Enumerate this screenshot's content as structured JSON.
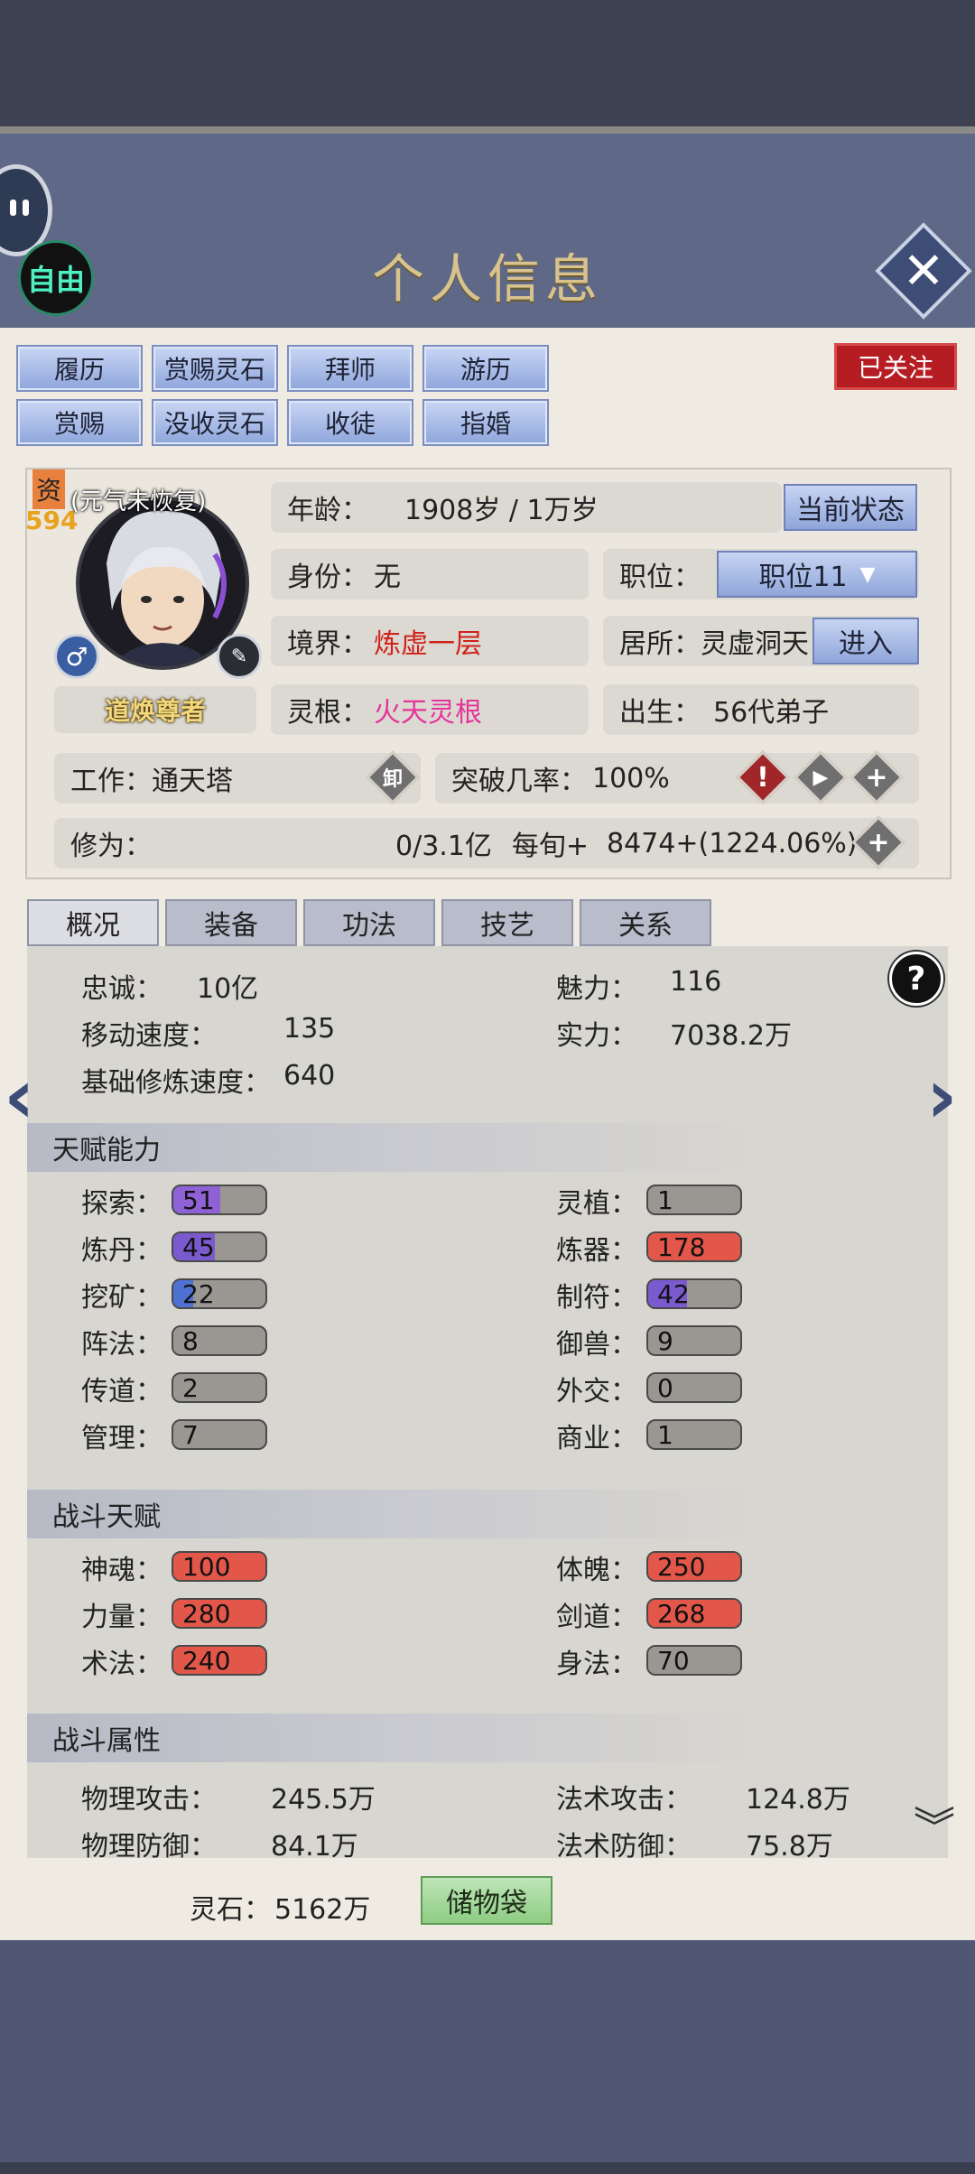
{
  "header": {
    "title": "个人信息",
    "free_label": "自由",
    "close_icon": "close-icon"
  },
  "top_buttons": [
    "履历",
    "赏赐灵石",
    "拜师",
    "游历",
    "赏赐",
    "没收灵石",
    "收徒",
    "指婚"
  ],
  "follow_label": "已关注",
  "character": {
    "zi_label": "资",
    "aptitude": "594",
    "status_note": "(元气未恢复)",
    "title_badge": "道焕尊者",
    "age_label": "年龄：",
    "age_value": "1908岁 / 1万岁",
    "current_status_label": "当前状态",
    "identity_label": "身份：",
    "identity_value": "无",
    "position_label": "职位：",
    "position_value": "职位11",
    "realm_label": "境界：",
    "realm_value": "炼虚一层",
    "residence_label": "居所：",
    "residence_value": "灵虚洞天",
    "enter_label": "进入",
    "root_label": "灵根：",
    "root_value": "火天灵根",
    "birth_label": "出生：",
    "birth_value": "56代弟子",
    "work_label": "工作：",
    "work_value": "通天塔",
    "unequip_label": "卸",
    "breakthrough_label": "突破几率：",
    "breakthrough_value": "100%",
    "cultivation_label": "修为：",
    "cultivation_value": "0/3.1亿",
    "per_turn_label": "每旬+",
    "per_turn_value": "8474+(1224.06%)"
  },
  "tabs": [
    "概况",
    "装备",
    "功法",
    "技艺",
    "关系"
  ],
  "overview": {
    "loyalty_label": "忠诚：",
    "loyalty_value": "10亿",
    "charm_label": "魅力：",
    "charm_value": "116",
    "speed_label": "移动速度：",
    "speed_value": "135",
    "power_label": "实力：",
    "power_value": "7038.2万",
    "base_speed_label": "基础修炼速度：",
    "base_speed_value": "640"
  },
  "talent_section": "天赋能力",
  "talents": [
    {
      "label": "探索：",
      "value": 51,
      "color": "#8f61d6"
    },
    {
      "label": "灵植：",
      "value": 1,
      "color": "#9a9793"
    },
    {
      "label": "炼丹：",
      "value": 45,
      "color": "#7b5ad0"
    },
    {
      "label": "炼器：",
      "value": 178,
      "color": "#e2574a"
    },
    {
      "label": "挖矿：",
      "value": 22,
      "color": "#4f72d2"
    },
    {
      "label": "制符：",
      "value": 42,
      "color": "#7b5ad0"
    },
    {
      "label": "阵法：",
      "value": 8,
      "color": "#9a9793"
    },
    {
      "label": "御兽：",
      "value": 9,
      "color": "#9a9793"
    },
    {
      "label": "传道：",
      "value": 2,
      "color": "#9a9793"
    },
    {
      "label": "外交：",
      "value": 0,
      "color": "#9a9793"
    },
    {
      "label": "管理：",
      "value": 7,
      "color": "#9a9793"
    },
    {
      "label": "商业：",
      "value": 1,
      "color": "#9a9793"
    }
  ],
  "combat_talent_section": "战斗天赋",
  "combat_talents": [
    {
      "label": "神魂：",
      "value": 100,
      "color": "#e2574a"
    },
    {
      "label": "体魄：",
      "value": 250,
      "color": "#e2574a"
    },
    {
      "label": "力量：",
      "value": 280,
      "color": "#e2574a"
    },
    {
      "label": "剑道：",
      "value": 268,
      "color": "#e2574a"
    },
    {
      "label": "术法：",
      "value": 240,
      "color": "#e2574a"
    },
    {
      "label": "身法：",
      "value": 70,
      "color": "#9a9793"
    }
  ],
  "combat_attr_section": "战斗属性",
  "combat_attrs": {
    "phys_atk_label": "物理攻击：",
    "phys_atk_value": "245.5万",
    "mag_atk_label": "法术攻击：",
    "mag_atk_value": "124.8万",
    "phys_def_label": "物理防御：",
    "phys_def_value": "84.1万",
    "mag_def_label": "法术防御：",
    "mag_def_value": "75.8万"
  },
  "footer": {
    "spirit_stone_label": "灵石：",
    "spirit_stone_value": "5162万",
    "storage_label": "储物袋"
  }
}
